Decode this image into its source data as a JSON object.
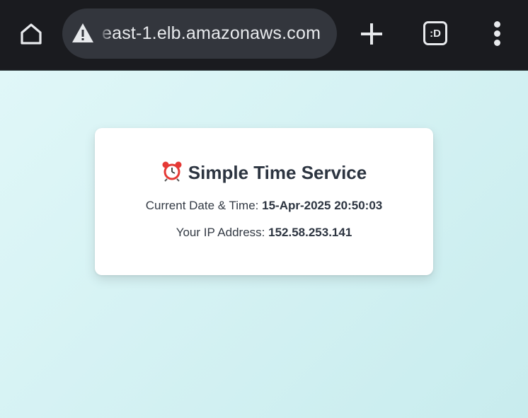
{
  "browser": {
    "url": "east-1.elb.amazonaws.com",
    "tabs_label": ":D"
  },
  "card": {
    "title": "Simple Time Service",
    "datetime_label": "Current Date & Time:",
    "datetime_value": "15-Apr-2025 20:50:03",
    "ip_label": "Your IP Address:",
    "ip_value": "152.58.253.141"
  },
  "colors": {
    "toolbar_bg": "#1a1b1f",
    "urlbar_bg": "#33363d",
    "page_bg_start": "#e0f7f8",
    "page_bg_end": "#c8ecee",
    "clock_red": "#e53935"
  }
}
